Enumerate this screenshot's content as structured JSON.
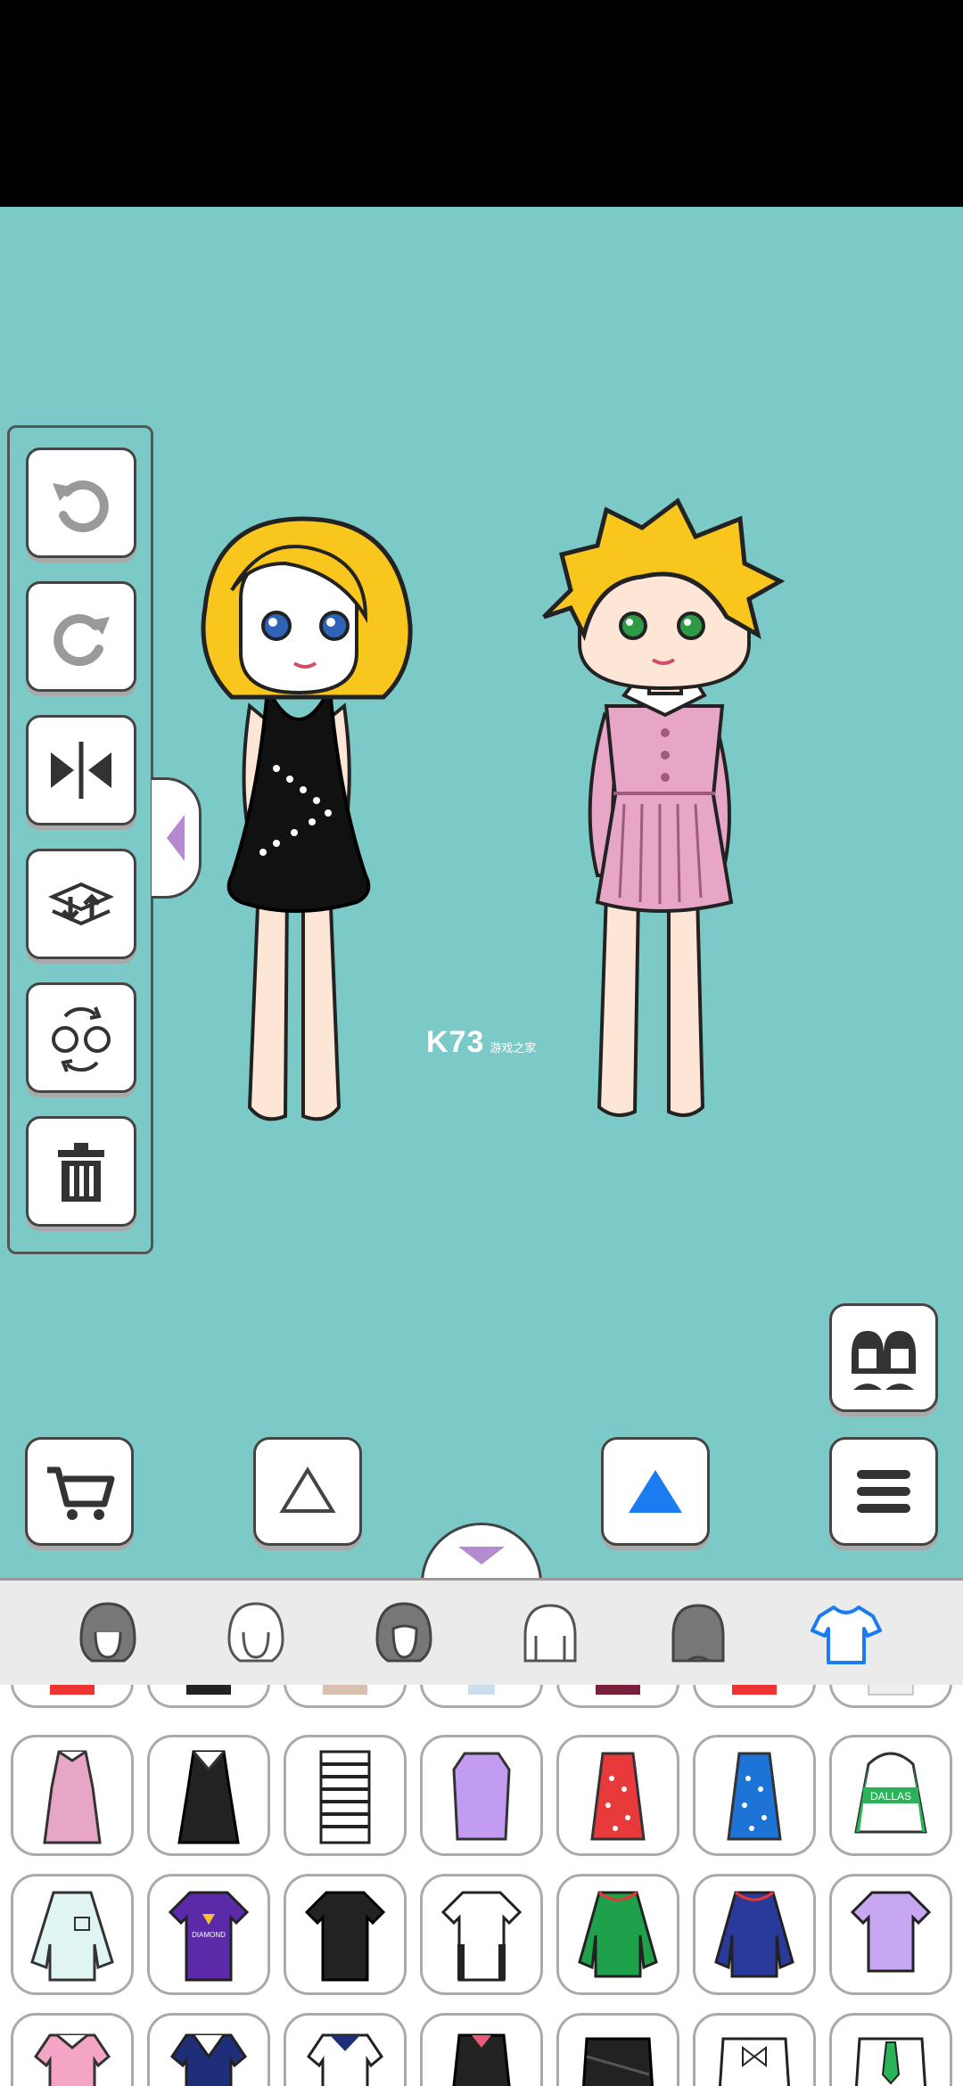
{
  "app": {
    "watermark_logo": "K73",
    "watermark_sub": "游戏之家"
  },
  "toolbar": [
    {
      "name": "undo-button",
      "icon": "undo-icon"
    },
    {
      "name": "redo-button",
      "icon": "redo-icon"
    },
    {
      "name": "flip-button",
      "icon": "flip-horizontal-icon"
    },
    {
      "name": "layer-order-button",
      "icon": "layer-swap-icon"
    },
    {
      "name": "swap-character-button",
      "icon": "character-swap-icon"
    },
    {
      "name": "delete-button",
      "icon": "trash-icon"
    }
  ],
  "bottom_controls": {
    "shop": "cart-icon",
    "select_left": "triangle-outline-icon",
    "select_right": "triangle-filled-icon",
    "menu": "hamburger-icon",
    "characters": "two-characters-icon",
    "collapse": "chevron-down-icon"
  },
  "categories": [
    {
      "name": "hair-style-1",
      "active": false
    },
    {
      "name": "hair-style-2",
      "active": false
    },
    {
      "name": "hair-style-3",
      "active": false
    },
    {
      "name": "hair-style-4",
      "active": false
    },
    {
      "name": "hair-style-5",
      "active": false
    },
    {
      "name": "tops",
      "active": true
    }
  ],
  "items": {
    "row1": [
      "pink-dress",
      "black-sailor-dress",
      "striped-turtleneck",
      "purple-tshirt-dress",
      "red-dotted-dress",
      "blue-dotted-dress",
      "green-dallas-hoodie"
    ],
    "row2": [
      "light-blue-shirt",
      "purple-graphic-tee",
      "black-layered-tee",
      "white-layered-tee",
      "green-sweatshirt",
      "navy-sweatshirt",
      "lavender-tee"
    ],
    "row2_text": {
      "purple_tee": "DIAMOND",
      "green_hoodie": "DALLAS"
    },
    "row3": [
      "pink-collar-top",
      "navy-sailor-top",
      "white-sailor-top",
      "black-coat",
      "black-wrap-top",
      "white-bow-blouse",
      "green-tie-shirt"
    ]
  },
  "colors": {
    "background": "#7ccac7",
    "accent": "#1b7cf2",
    "outline": "#444444"
  }
}
